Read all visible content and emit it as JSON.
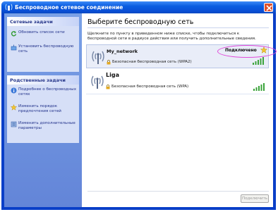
{
  "window": {
    "title": "Беспроводное сетевое соединение",
    "title_icon": "wireless-network-icon",
    "close_icon": "close-icon"
  },
  "sidebar": {
    "network_tasks": {
      "heading": "Сетевые задачи",
      "items": [
        {
          "label": "Обновить список сети",
          "icon": "refresh-icon"
        },
        {
          "label": "Установить беспроводную сеть",
          "icon": "setup-network-icon"
        }
      ]
    },
    "related_tasks": {
      "heading": "Родственные задачи",
      "items": [
        {
          "label": "Подробнее о беспроводных сетях",
          "icon": "info-icon"
        },
        {
          "label": "Изменить порядок предпочтения сетей",
          "icon": "star-icon"
        },
        {
          "label": "Изменить дополнительные параметры",
          "icon": "settings-icon"
        }
      ]
    }
  },
  "main": {
    "title": "Выберите беспроводную сеть",
    "instruction": "Щелкните по пункту в приведенном ниже списке, чтобы подключиться к беспроводной сети в радиусе действия или получить дополнительные сведения.",
    "networks": [
      {
        "name": "My_network",
        "security": "Безопасная беспроводная сеть (WPA2)",
        "status": "Подключено",
        "selected": true,
        "signal_bars": 5
      },
      {
        "name": "Liga",
        "security": "Безопасная беспроводная сеть (WPA)",
        "status": "",
        "selected": false,
        "signal_bars": 5
      }
    ],
    "connect_button": "Подключить"
  },
  "colors": {
    "titlebar": "#0a4fd6",
    "sidebar": "#6f92de",
    "panel": "#d6dff7",
    "highlight_ring": "#e04ad9",
    "signal": "#3aa33a"
  }
}
